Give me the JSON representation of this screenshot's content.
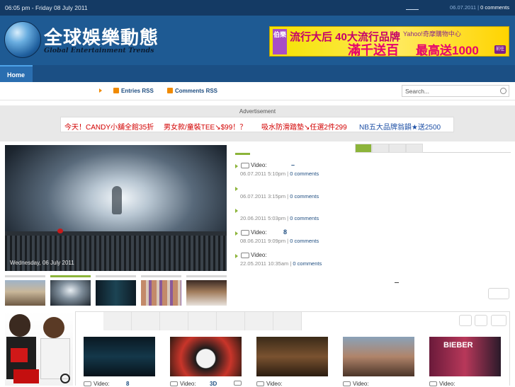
{
  "topbar": {
    "datetime": "06:05 pm - Friday 08 July 2011",
    "meta_date": "06.07.2011",
    "meta_sep": " | ",
    "meta_comments": "0 comments"
  },
  "header": {
    "logo_cn": "全球娛樂動態",
    "logo_en": "Global Entertainment Trends",
    "ad": {
      "left_tag": "伯樂",
      "headline": "流行大后 40大流行品牌",
      "portal": "Yahoo!奇摩購物中心",
      "line2a": "滿千送百",
      "line2b": "最高送1000",
      "go": "前往"
    }
  },
  "nav": {
    "home": "Home"
  },
  "subbar": {
    "entries_rss": "Entries RSS",
    "comments_rss": "Comments RSS",
    "search_placeholder": "Search..."
  },
  "adstrip": {
    "label": "Advertisement",
    "links": [
      "今天！CANDY小舖全館35折",
      "男女款/童裝TEE↘$99！？",
      "吸水防滑踏墊↘任選2件299",
      "NB五大品牌翁韻★送2500"
    ]
  },
  "feature": {
    "caption": "Wednesday, 06 July 2011"
  },
  "video_list": [
    {
      "title": "Video:",
      "extra": "–",
      "date": "06.07.2011 5:10pm",
      "comments": "0 comments",
      "camera": true
    },
    {
      "title": "",
      "extra": "",
      "date": "06.07.2011 3:15pm",
      "comments": "0 comments",
      "camera": false
    },
    {
      "title": "",
      "extra": "",
      "date": "20.06.2011 5:03pm",
      "comments": "0 comments",
      "camera": false
    },
    {
      "title": "Video:",
      "extra": "8",
      "date": "08.06.2011 9:09pm",
      "comments": "0 comments",
      "camera": true
    },
    {
      "title": "Video:",
      "extra": "",
      "date": "22.05.2011 10:35am",
      "comments": "0 comments",
      "camera": true
    }
  ],
  "video_panel": {
    "items": [
      {
        "label": "Video:",
        "extra": "8"
      },
      {
        "label": "Video:",
        "extra": "3D"
      },
      {
        "label": "Video:",
        "extra": ""
      },
      {
        "label": "Video:",
        "extra": ""
      },
      {
        "label": "Video:",
        "extra": ""
      }
    ],
    "thumb_texts": [
      "",
      "",
      "",
      "",
      "BIEBER"
    ]
  },
  "colors": {
    "topbar": "#143a64",
    "header": "#1e5a93",
    "accent_green": "#8cb43a",
    "rss_orange": "#f08a00",
    "link_blue": "#1e4d80"
  }
}
